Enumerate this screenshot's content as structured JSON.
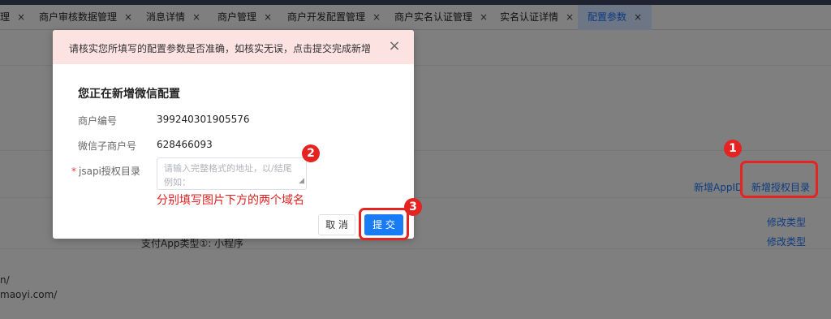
{
  "tabs": [
    {
      "label": "理",
      "closable": true,
      "active": false
    },
    {
      "label": "商户审核数据管理",
      "closable": true,
      "active": false
    },
    {
      "label": "消息详情",
      "closable": true,
      "active": false
    },
    {
      "label": "商户管理",
      "closable": true,
      "active": false
    },
    {
      "label": "商户开发配置管理",
      "closable": true,
      "active": false
    },
    {
      "label": "商户实名认证管理",
      "closable": true,
      "active": false
    },
    {
      "label": "实名认证详情",
      "closable": true,
      "active": false
    },
    {
      "label": "配置参数",
      "closable": true,
      "active": true
    }
  ],
  "tab_close_glyph": "×",
  "background": {
    "add_appid_link": "新增AppID",
    "add_jsapi_link": "新增授权目录",
    "modify_type_1": "修改类型",
    "modify_type_2": "修改类型",
    "partial_text_1": "支付App类型①:   小程序",
    "domain_1": "n/",
    "domain_2": "maoyi.com/"
  },
  "modal": {
    "warning": "请核实您所填写的配置参数是否准确，如核实无误，点击提交完成新增",
    "close_icon": "×",
    "title": "您正在新增微信配置",
    "fields": {
      "merchant_no_label": "商户编号",
      "merchant_no_value": "399240301905576",
      "sub_mch_label": "微信子商户号",
      "sub_mch_value": "628466093",
      "jsapi_label": "jsapi授权目录",
      "jsapi_required_mark": "*",
      "jsapi_placeholder": "请输入完整格式的地址，以/结尾 例如：https://www.weixin.com/"
    },
    "cancel_label": "取 消",
    "submit_label": "提 交"
  },
  "annotations": {
    "hint_text": "分别填写图片下方的两个域名",
    "badge_1": "1",
    "badge_2": "2",
    "badge_3": "3"
  },
  "colors": {
    "accent": "#1a7cf5",
    "annotation_red": "#e52421",
    "warning_bg": "#fde2e2"
  }
}
